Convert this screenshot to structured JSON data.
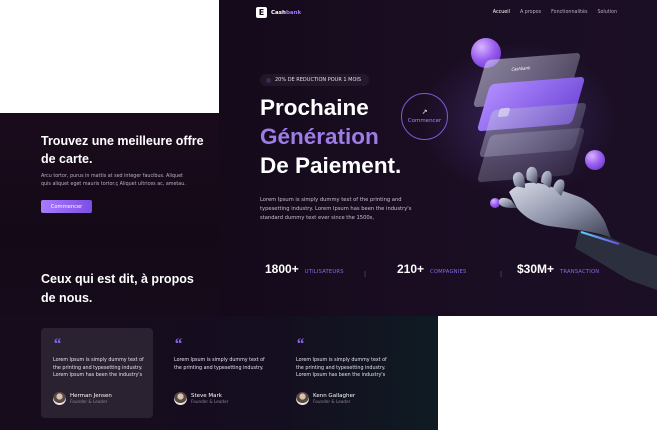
{
  "brand": {
    "mark": "E",
    "name_a": "Cash",
    "name_b": "bank"
  },
  "nav": {
    "items": [
      "Accueil",
      "A propos",
      "Fonctionnalités",
      "Solution"
    ],
    "active_index": 0
  },
  "hero": {
    "promo": "20% DE REDUCTION POUR 1 MOIS",
    "title_line1": "Prochaine",
    "title_line2": "Génération",
    "title_line3": "De Paiement.",
    "description": "Lorem Ipsum is simply dummy text of the printing and typesetting industry. Lorem Ipsum has been the industry's standard dummy text ever since the 1500s,",
    "cta": "Commencer",
    "cta_arrow": "↗",
    "card_brand": "Cashbank"
  },
  "stats": [
    {
      "value": "1800+",
      "label": "UTILISATEURS"
    },
    {
      "value": "210+",
      "label": "COMPAGNIES"
    },
    {
      "value": "$30M+",
      "label": "TRANSACTION"
    }
  ],
  "offer": {
    "title": "Trouvez une meilleure offre de carte.",
    "text": "Arcu tortor, purus in mattis at sed integer faucibus. Aliquet quis aliquet eget mauris tortor.ç Aliquet ultrices ac, ametau.",
    "button": "Commencer"
  },
  "testimonials": {
    "title": "Ceux qui est dit, à propos de nous.",
    "quote_mark": "“",
    "items": [
      {
        "text": "Lorem Ipsum is simply dummy text of the printing and typesetting industry. Lorem Ipsum has been the industry's",
        "name": "Herman Jensen",
        "role": "Founder & Leader"
      },
      {
        "text": "Lorem Ipsum is simply dummy text of the printing and typesetting industry.",
        "name": "Steve Mark",
        "role": "Founder & Leader"
      },
      {
        "text": "Lorem Ipsum is simply dummy text of the printing and typesetting industry. Lorem Ipsum has been the industry's",
        "name": "Kenn Gallagher",
        "role": "Founder & Leader"
      }
    ]
  },
  "colors": {
    "accent": "#9d7ce8",
    "button": "#8f62f2",
    "background": "#160b1c"
  }
}
